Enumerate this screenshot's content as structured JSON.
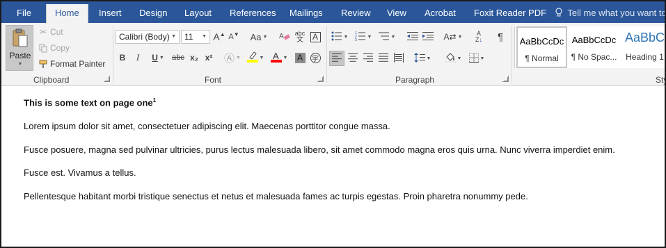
{
  "tabs": [
    {
      "label": "File"
    },
    {
      "label": "Home"
    },
    {
      "label": "Insert"
    },
    {
      "label": "Design"
    },
    {
      "label": "Layout"
    },
    {
      "label": "References"
    },
    {
      "label": "Mailings"
    },
    {
      "label": "Review"
    },
    {
      "label": "View"
    },
    {
      "label": "Acrobat"
    },
    {
      "label": "Foxit Reader PDF"
    }
  ],
  "tell_me": "Tell me what you want to d",
  "clipboard": {
    "paste": "Paste",
    "cut": "Cut",
    "copy": "Copy",
    "format_painter": "Format Painter",
    "label": "Clipboard"
  },
  "font": {
    "name": "Calibri (Body)",
    "size": "11",
    "label": "Font",
    "case_label": "Aa",
    "bold": "B",
    "italic": "I",
    "underline": "U",
    "strike": "abc",
    "subscript": "x₂",
    "superscript": "x²",
    "grow": "A",
    "shrink": "A"
  },
  "paragraph": {
    "label": "Paragraph",
    "pilcrow": "¶"
  },
  "styles": [
    {
      "sample": "AaBbCcDc",
      "name": "¶ Normal"
    },
    {
      "sample": "AaBbCcDc",
      "name": "¶ No Spac..."
    },
    {
      "sample": "AaBbC",
      "name": "Heading 1"
    }
  ],
  "styles_label": "Sty",
  "colors": {
    "accent": "#2b579a",
    "highlight": "#ffff00",
    "font_color": "#ff0000"
  },
  "document": {
    "heading": "This is some text on page one",
    "heading_sup": "1",
    "paragraphs": [
      "Lorem ipsum dolor sit amet, consectetuer adipiscing elit. Maecenas porttitor congue massa.",
      "Fusce posuere, magna sed pulvinar ultricies, purus lectus malesuada libero, sit amet commodo magna eros quis urna. Nunc viverra imperdiet enim.",
      "Fusce est. Vivamus a tellus.",
      "Pellentesque habitant morbi tristique senectus et netus et malesuada fames ac turpis egestas. Proin pharetra nonummy pede."
    ]
  }
}
